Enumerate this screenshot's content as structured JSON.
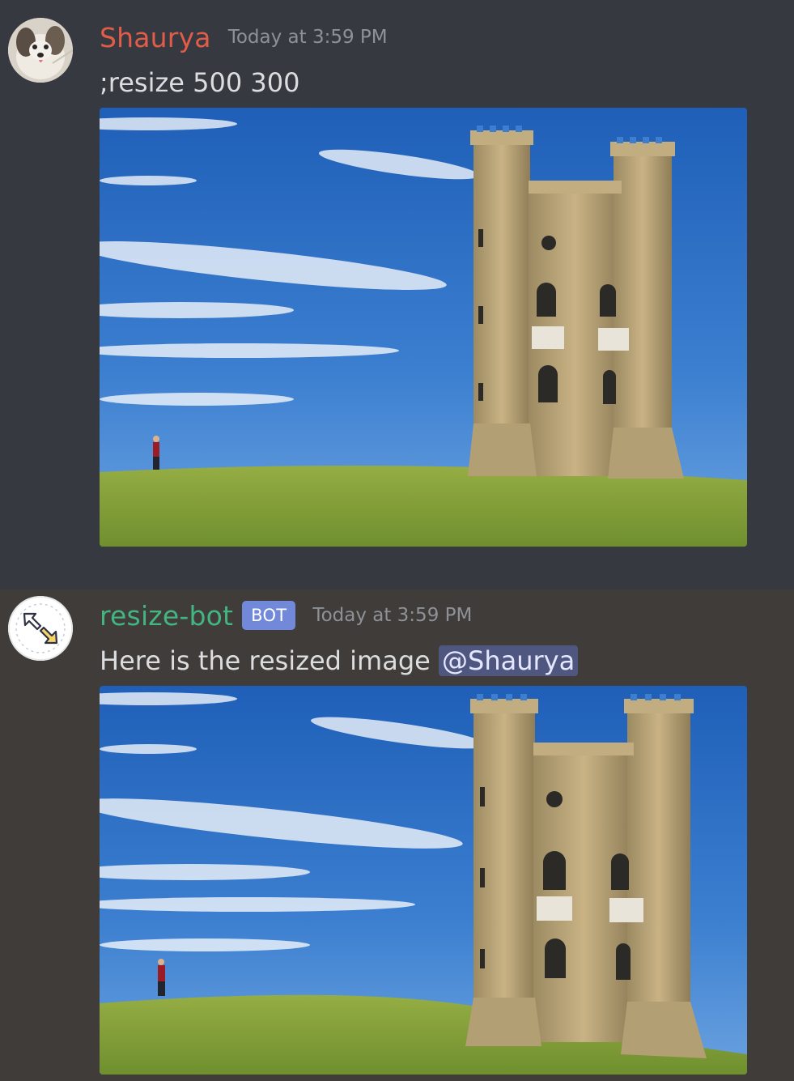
{
  "messages": [
    {
      "author": "Shaurya",
      "timestamp": "Today at 3:59 PM",
      "text": ";resize 500 300",
      "author_color": "#e25c4a",
      "attachment": "castle-photo-original"
    },
    {
      "author": "resize-bot",
      "bot_tag": "BOT",
      "timestamp": "Today at 3:59 PM",
      "text": "Here is the resized image",
      "mention": "@Shaurya",
      "author_color": "#43b581",
      "attachment": "castle-photo-resized"
    }
  ],
  "colors": {
    "background": "#36393f",
    "bot_tag": "#7289da",
    "mention_bg": "#4f5680"
  }
}
